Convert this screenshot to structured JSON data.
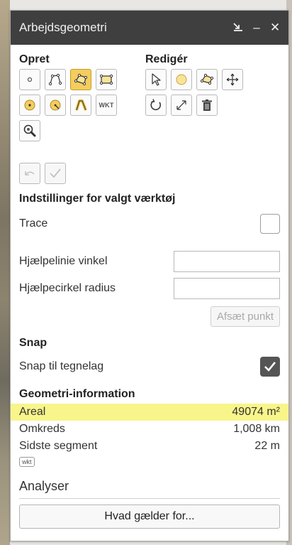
{
  "window": {
    "title": "Arbejdsgeometri",
    "dock_icon": "dock-icon",
    "minimize_label": "–",
    "close_label": "✕"
  },
  "tools": {
    "create_title": "Opret",
    "edit_title": "Redigér",
    "wkt_label": "WKT"
  },
  "settings": {
    "title": "Indstillinger for valgt værktøj",
    "trace_label": "Trace",
    "trace_checked": false,
    "helper_angle_label": "Hjælpelinie vinkel",
    "helper_angle_value": "",
    "helper_radius_label": "Hjælpecirkel radius",
    "helper_radius_value": "",
    "place_point_label": "Afsæt punkt"
  },
  "snap": {
    "title": "Snap",
    "label": "Snap til tegnelag",
    "checked": true
  },
  "geometry_info": {
    "title": "Geometri-information",
    "rows": [
      {
        "label": "Areal",
        "value": "49074 m²",
        "highlight": true
      },
      {
        "label": "Omkreds",
        "value": "1,008 km",
        "highlight": false
      },
      {
        "label": "Sidste segment",
        "value": "22 m",
        "highlight": false
      }
    ],
    "wkt_tag": "wkt"
  },
  "analysis": {
    "title": "Analyser",
    "button_label": "Hvad gælder for..."
  },
  "colors": {
    "titlebar": "#3f3f3f",
    "active_tool": "#f5cd5e",
    "highlight": "#f8f58a"
  }
}
